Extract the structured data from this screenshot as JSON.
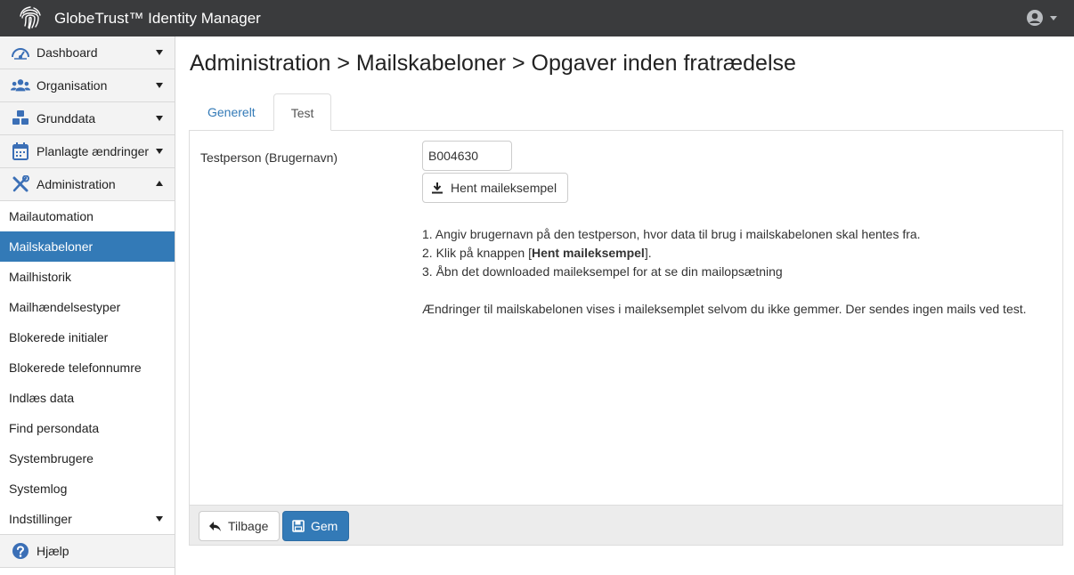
{
  "app": {
    "title": "GlobeTrust™ Identity Manager"
  },
  "sidebar": {
    "sections": [
      {
        "label": "Dashboard",
        "icon": "dashboard-icon"
      },
      {
        "label": "Organisation",
        "icon": "users-icon"
      },
      {
        "label": "Grunddata",
        "icon": "cubes-icon"
      },
      {
        "label": "Planlagte ændringer",
        "icon": "calendar-icon"
      },
      {
        "label": "Administration",
        "icon": "tools-icon"
      }
    ],
    "admin_items": [
      "Mailautomation",
      "Mailskabeloner",
      "Mailhistorik",
      "Mailhændelsestyper",
      "Blokerede initialer",
      "Blokerede telefonnumre",
      "Indlæs data",
      "Find persondata",
      "Systembrugere",
      "Systemlog",
      "Indstillinger"
    ],
    "active_item": "Mailskabeloner",
    "help": {
      "label": "Hjælp",
      "icon": "question-circle-icon"
    }
  },
  "breadcrumb": "Administration > Mailskabeloner > Opgaver inden fratrædelse",
  "tabs": [
    {
      "label": "Generelt",
      "active": false
    },
    {
      "label": "Test",
      "active": true
    }
  ],
  "form": {
    "testperson_label": "Testperson (Brugernavn)",
    "testperson_value": "B004630",
    "download_button": "Hent maileksempel"
  },
  "instructions": {
    "step1": "1. Angiv brugernavn på den testperson, hvor data til brug i mailskabelonen skal hentes fra.",
    "step2_prefix": "2. Klik på knappen [",
    "step2_bold": "Hent maileksempel",
    "step2_suffix": "].",
    "step3": "3. Åbn det downloaded maileksempel for at se din mailopsætning",
    "note": "Ændringer til mailskabelonen vises i maileksemplet selvom du ikke gemmer. Der sendes ingen mails ved test."
  },
  "footer": {
    "back_label": "Tilbage",
    "save_label": "Gem"
  },
  "colors": {
    "topbar": "#3a3b3d",
    "accent": "#337ab7",
    "icon_blue": "#3b6fb6"
  }
}
